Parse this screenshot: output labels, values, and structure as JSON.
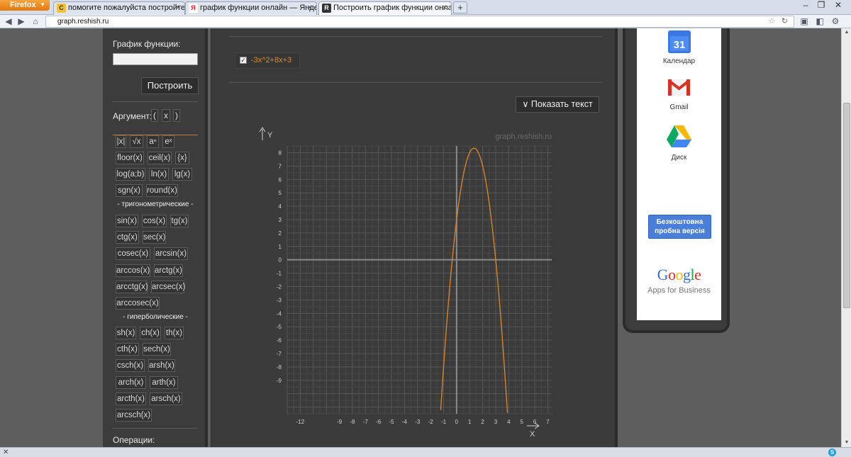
{
  "browser": {
    "menu_button": "Firefox",
    "tabs": [
      {
        "label": "помогите пожалуйста постройте г....",
        "favicon": "С"
      },
      {
        "label": "график функции онлайн — Яндекс: ...",
        "favicon": "Я"
      },
      {
        "label": "Построить график функции онлайн",
        "favicon": "R"
      }
    ],
    "new_tab": "+",
    "url_domain": "graph.reshish.ru"
  },
  "sidebar": {
    "function_label": "График функции:",
    "function_value": "",
    "build_button": "Построить",
    "argument_label": "Аргумент:",
    "argument_buttons": [
      "(",
      "x",
      ")"
    ],
    "basic_functions": [
      "|x|",
      "√x",
      "aⁿ",
      "eˣ",
      "floor(x)",
      "ceil(x)",
      "{x}",
      "log(a;b)",
      "ln(x)",
      "lg(x)",
      "sgn(x)",
      "round(x)"
    ],
    "trig_title": "- тригонометрические -",
    "trig_functions": [
      "sin(x)",
      "cos(x)",
      "tg(x)",
      "ctg(x)",
      "sec(x)",
      "cosec(x)",
      "arcsin(x)",
      "arccos(x)",
      "arctg(x)",
      "arcctg(x)",
      "arcsec(x)",
      "arccosec(x)"
    ],
    "hyper_title": "- гиперболические -",
    "hyper_functions": [
      "sh(x)",
      "ch(x)",
      "th(x)",
      "cth(x)",
      "sech(x)",
      "csch(x)",
      "arsh(x)",
      "arch(x)",
      "arth(x)",
      "arcth(x)",
      "arsch(x)",
      "arcsch(x)"
    ],
    "operations_label": "Операции:"
  },
  "main": {
    "function_chip": "-3x^2+8x+3",
    "function_checked": true,
    "show_text_button": "∨ Показать текст",
    "watermark": "graph.reshish.ru"
  },
  "chart_data": {
    "type": "line",
    "series": [
      {
        "name": "-3x^2+8x+3",
        "formula": "-3x^2+8x+3",
        "color": "#d9822b"
      }
    ],
    "xlabel": "X",
    "ylabel": "Y",
    "xlim": [
      -13,
      7.3
    ],
    "ylim": [
      -11.5,
      8.5
    ],
    "x_ticks": [
      -12,
      -9,
      -8,
      -7,
      -6,
      -5,
      -4,
      -3,
      -2,
      -1,
      0,
      1,
      2,
      3,
      4,
      5,
      6,
      7
    ],
    "y_ticks": [
      8,
      7,
      6,
      5,
      4,
      3,
      2,
      1,
      0,
      -1,
      -2,
      -3,
      -4,
      -5,
      -6,
      -7,
      -8,
      -9
    ],
    "grid": true
  },
  "ads": {
    "apps": [
      {
        "name": "Календар",
        "icon": "calendar-icon"
      },
      {
        "name": "Gmail",
        "icon": "gmail-icon"
      },
      {
        "name": "Диск",
        "icon": "drive-icon"
      }
    ],
    "calendar_day": "31",
    "trial_button": "Безкоштовна пробна версія",
    "google_logo": "Google",
    "apps_for_business": "Apps for Business"
  }
}
